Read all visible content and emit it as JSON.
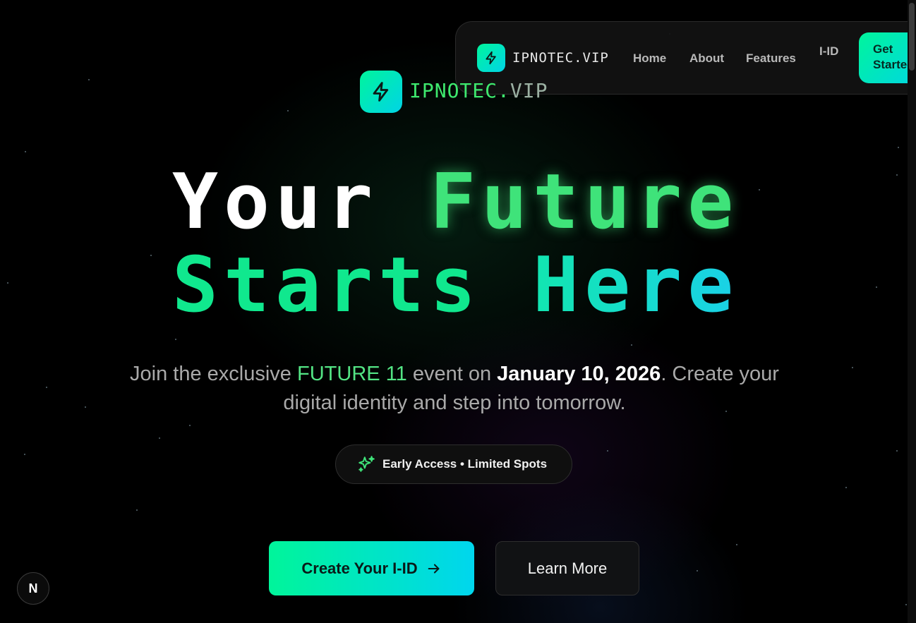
{
  "colors": {
    "accent_green": "#00f59c",
    "accent_cyan": "#00d4e6",
    "future_green": "#3fe37a",
    "background": "#000000"
  },
  "nav": {
    "logo_icon": "lightning-bolt-icon",
    "brand": "IPNOTEC.VIP",
    "links": [
      "Home",
      "About",
      "Features"
    ],
    "iid_label": "I-ID",
    "cta_label": "Get Started"
  },
  "hero": {
    "logo_icon": "lightning-bolt-icon",
    "brand_part1": "IPNOTEC.",
    "brand_part2": "VIP",
    "headline": {
      "word1": "Your",
      "word2": "Future",
      "word3": "Starts",
      "word4": "Here"
    },
    "subtitle": {
      "pre": "Join the exclusive ",
      "highlight": "FUTURE 11",
      "mid": " event on ",
      "date": "January 10, 2026",
      "post": ". Create your digital identity and step into tomorrow."
    },
    "pill": {
      "icon": "sparkles-icon",
      "text": "Early Access • Limited Spots"
    },
    "primary_button": "Create Your I-ID",
    "primary_button_icon": "arrow-right-icon",
    "secondary_button": "Learn More"
  },
  "dev_badge": "N"
}
